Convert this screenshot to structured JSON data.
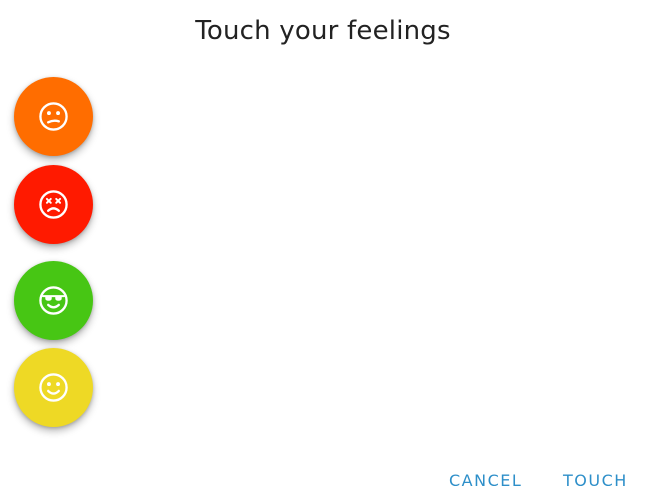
{
  "dialog": {
    "title": "Touch your feelings"
  },
  "feelings": [
    {
      "icon": "confused-face-icon",
      "color": "#FF6D00"
    },
    {
      "icon": "dizzy-face-icon",
      "color": "#FF1A00"
    },
    {
      "icon": "cool-sunglasses-face-icon",
      "color": "#47C614"
    },
    {
      "icon": "smiling-face-icon",
      "color": "#EED925"
    }
  ],
  "actions": {
    "cancel_label": "CANCEL",
    "touch_label": "TOUCH",
    "color": "#2E8FC9"
  }
}
